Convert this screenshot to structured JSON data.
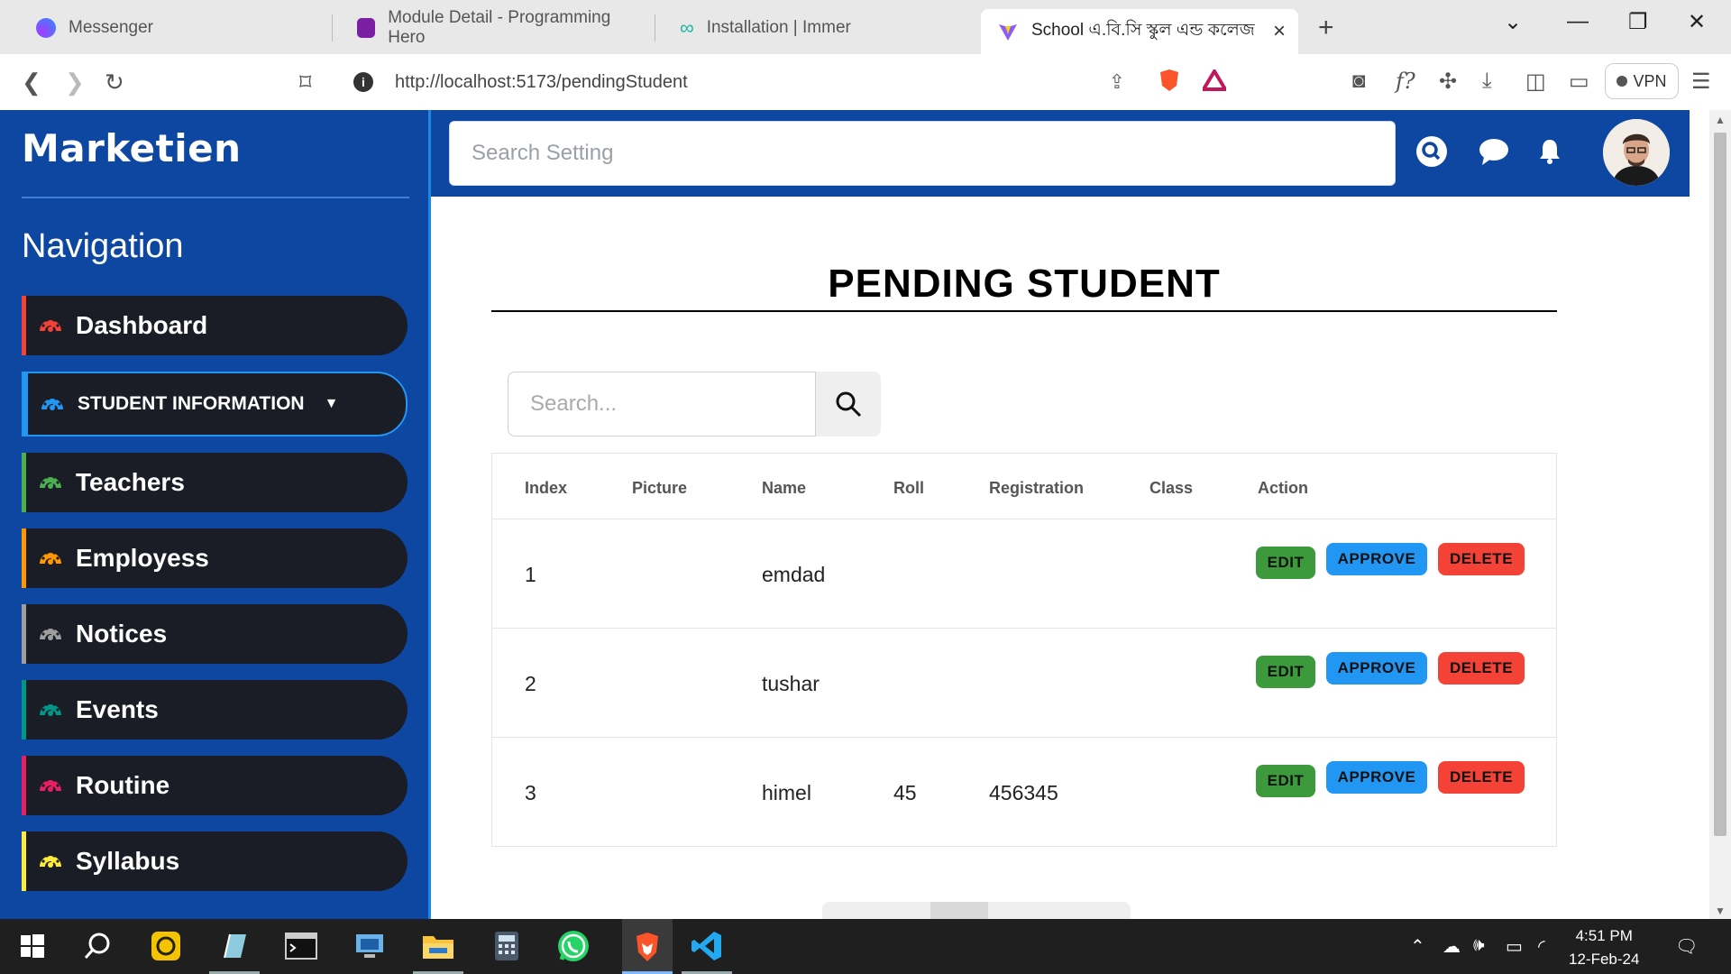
{
  "browser": {
    "tabs": [
      {
        "title": "Messenger"
      },
      {
        "title": "Module Detail - Programming Hero"
      },
      {
        "title": "Installation | Immer"
      },
      {
        "title": "School এ.বি.সি স্কুল এন্ড কলেজ"
      }
    ],
    "url_host": "http://localhost",
    "url_path": ":5173/pendingStudent",
    "vpn_label": "VPN"
  },
  "sidebar": {
    "brand": "Marketien",
    "nav_title": "Navigation",
    "items": [
      {
        "label": "Dashboard",
        "color": "#f44336"
      },
      {
        "label": "STUDENT INFORMATION",
        "color": "#2196f3"
      },
      {
        "label": "Teachers",
        "color": "#4caf50"
      },
      {
        "label": "Employess",
        "color": "#ff9800"
      },
      {
        "label": "Notices",
        "color": "#9e9e9e"
      },
      {
        "label": "Events",
        "color": "#009688"
      },
      {
        "label": "Routine",
        "color": "#e91e63"
      },
      {
        "label": "Syllabus",
        "color": "#ffeb3b"
      }
    ]
  },
  "header": {
    "search_placeholder": "Search Setting"
  },
  "main": {
    "title": "PENDING STUDENT",
    "search_placeholder": "Search..."
  },
  "table": {
    "headers": [
      "Index",
      "Picture",
      "Name",
      "Roll",
      "Registration",
      "Class",
      "Action"
    ],
    "rows": [
      {
        "index": "1",
        "name": "emdad",
        "roll": "",
        "registration": ""
      },
      {
        "index": "2",
        "name": "tushar",
        "roll": "",
        "registration": ""
      },
      {
        "index": "3",
        "name": "himel",
        "roll": "45",
        "registration": "456345"
      }
    ],
    "actions": {
      "edit": "EDIT",
      "approve": "APPROVE",
      "delete": "DELETE"
    }
  },
  "taskbar": {
    "time": "4:51 PM",
    "date": "12-Feb-24"
  }
}
